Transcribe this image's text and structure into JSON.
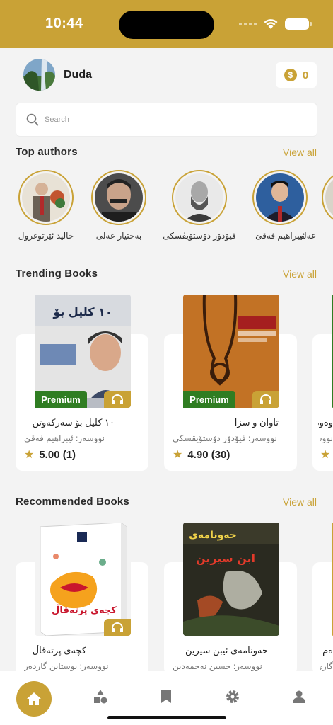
{
  "status_bar": {
    "time": "10:44"
  },
  "profile": {
    "username": "Duda",
    "coins": "0"
  },
  "search": {
    "placeholder": "Search"
  },
  "sections": {
    "top_authors": {
      "title": "Top authors",
      "view_all": "View all"
    },
    "trending": {
      "title": "Trending Books",
      "view_all": "View all"
    },
    "recommended": {
      "title": "Recommended Books",
      "view_all": "View all"
    }
  },
  "authors": [
    {
      "name": "خالید ئێرتوغرول"
    },
    {
      "name": "بەختیار عەلی"
    },
    {
      "name": "فیۆدۆر دۆستۆیڤسکی"
    },
    {
      "name": "ئیبراهیم فەقێ"
    },
    {
      "name": "عەلی"
    }
  ],
  "trending_books": [
    {
      "title": "١٠ کلیل بۆ سەرکەوتن",
      "author": "نووسەر: ئیبراهیم فەقێ",
      "rating": "5.00 (1)",
      "badge": "Premium"
    },
    {
      "title": "تاوان و سزا",
      "author": "نووسەر: فیۆدۆر دۆستۆیڤسکی",
      "rating": "4.90 (30)",
      "badge": "Premium"
    },
    {
      "title": "وەوە",
      "author": "نووسەر: د",
      "rating": ""
    }
  ],
  "recommended_books": [
    {
      "title": "کچەی پرتەقاڵ",
      "author": "نووسەر: یوستاین گاردەر"
    },
    {
      "title": "خەونامەی ئیبن سیرین",
      "author": "نووسەر: حسین نەجمەدین"
    },
    {
      "title": "ەم",
      "author": "گاری"
    }
  ],
  "colors": {
    "accent": "#c9a236",
    "premium": "#2f7d22",
    "background": "#f3f3f3"
  },
  "tabbar": {
    "items": [
      {
        "icon": "home-icon",
        "active": true
      },
      {
        "icon": "categories-icon",
        "active": false
      },
      {
        "icon": "bookmark-icon",
        "active": false
      },
      {
        "icon": "settings-icon",
        "active": false
      },
      {
        "icon": "profile-icon",
        "active": false
      }
    ]
  }
}
